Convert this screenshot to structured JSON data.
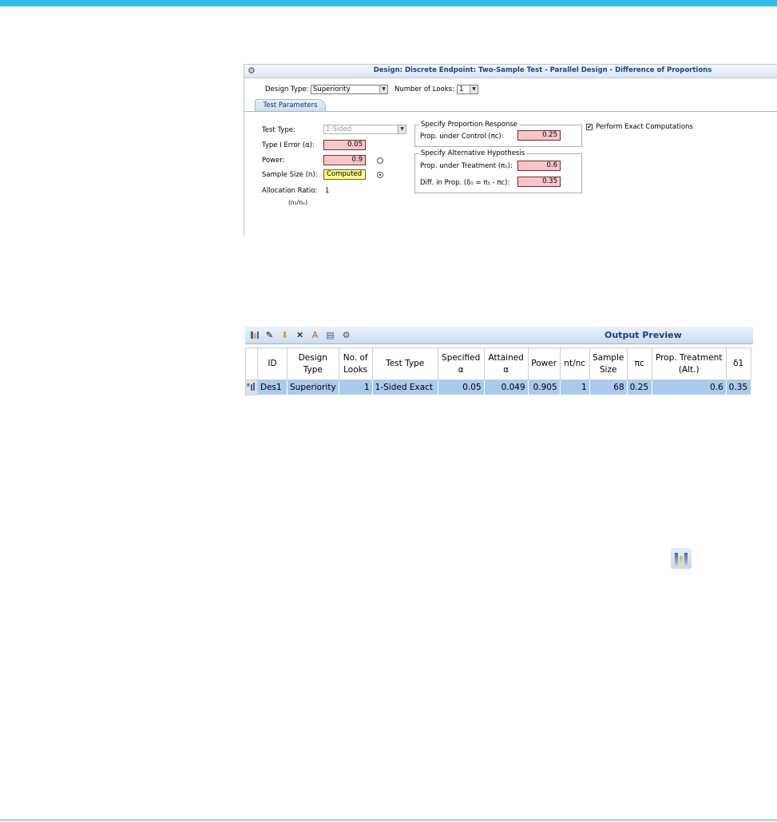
{
  "colors": {
    "accent_bar": "#33bde8",
    "title_text": "#1b3f8f",
    "input_pink": "#f7c6c9",
    "input_yellow": "#fcfc8a",
    "row_highlight": "#a9c9ef"
  },
  "design": {
    "title": "Design: Discrete Endpoint: Two-Sample Test - Parallel Design - Difference of Proportions",
    "design_type_label": "Design Type:",
    "design_type_value": "Superiority",
    "looks_label": "Number of Looks:",
    "looks_value": "1",
    "tab": "Test Parameters",
    "test_type_label": "Test Type:",
    "test_type_value": "1-Sided",
    "alpha_label": "Type I Error (α):",
    "alpha_value": "0.05",
    "power_label": "Power:",
    "power_value": "0.9",
    "sample_size_label": "Sample Size (n):",
    "sample_size_value": "Computed",
    "allocation_label": "Allocation Ratio:",
    "allocation_sub": "(n₁/nₑ)",
    "allocation_value": "1",
    "prop_response_group": "Specify Proportion Response",
    "prop_control_label": "Prop. under Control (πc):",
    "prop_control_value": "0.25",
    "alt_hyp_group": "Specify Alternative Hypothesis",
    "prop_treatment_label": "Prop. under Treatment (π₁):",
    "prop_treatment_value": "0.6",
    "diff_label": "Diff. in Prop. (δ₁ = π₁ - πc):",
    "diff_value": "0.35",
    "exact_label": "Perform Exact Computations",
    "exact_checked": true
  },
  "output": {
    "title": "Output Preview",
    "toolbar_icons": [
      "bar-chart-icon",
      "edit-icon",
      "save-icon",
      "delete-icon",
      "rename-icon",
      "print-icon",
      "settings-icon"
    ],
    "columns": [
      "ID",
      "Design Type",
      "No. of Looks",
      "Test Type",
      "Specified α",
      "Attained α",
      "Power",
      "nt/nc",
      "Sample Size",
      "πc",
      "Prop. Treatment (Alt.)",
      "δ1"
    ],
    "rows": [
      [
        "Des1",
        "Superiority",
        "1",
        "1-Sided Exact",
        "0.05",
        "0.049",
        "0.905",
        "1",
        "68",
        "0.25",
        "0.6",
        "0.35"
      ]
    ]
  }
}
